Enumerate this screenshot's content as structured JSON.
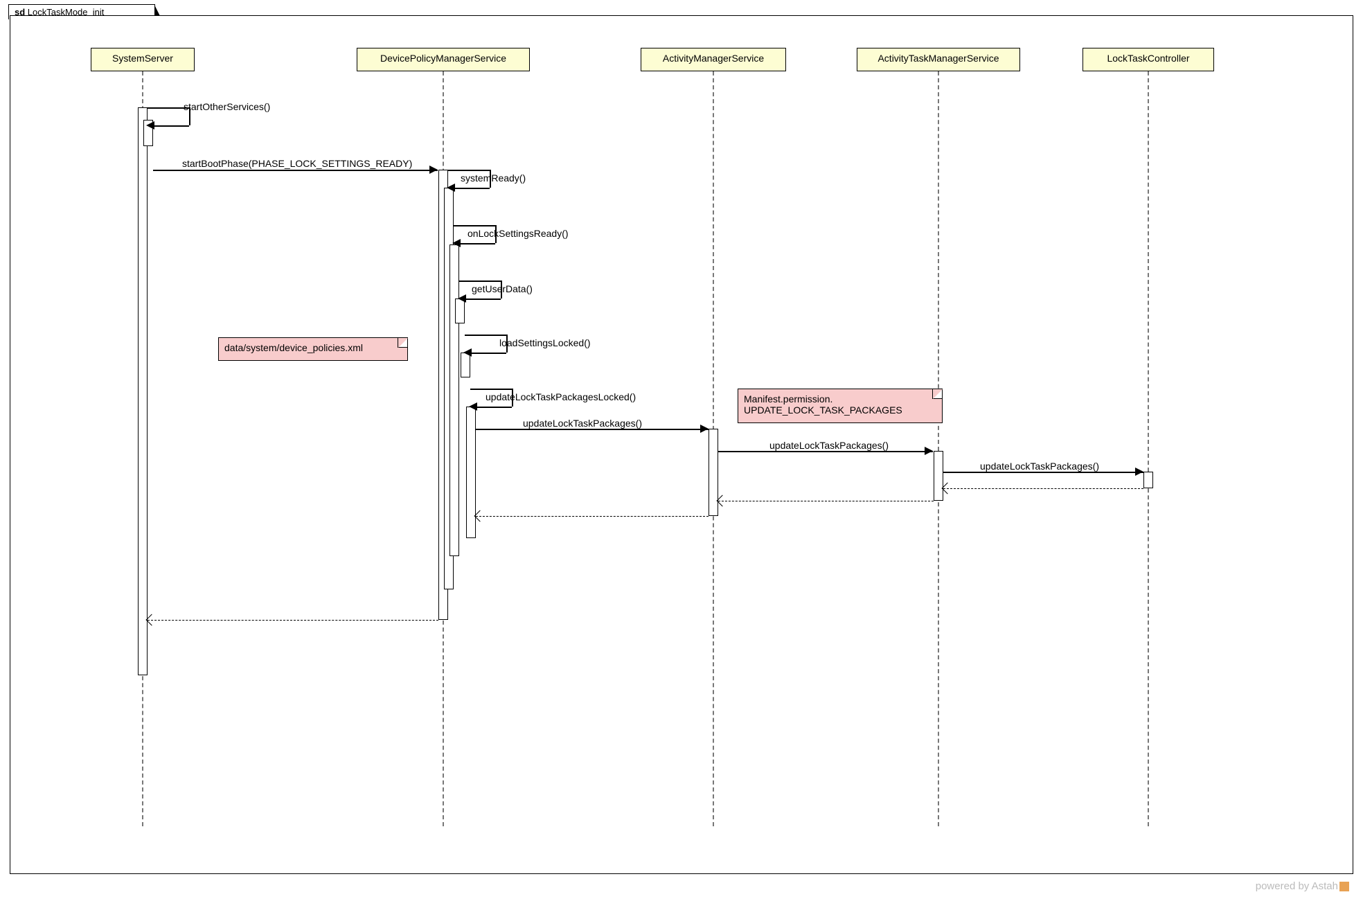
{
  "diagram": {
    "title_prefix": "sd",
    "title": "LockTaskMode_init"
  },
  "lifelines": {
    "l1": "SystemServer",
    "l2": "DevicePolicyManagerService",
    "l3": "ActivityManagerService",
    "l4": "ActivityTaskManagerService",
    "l5": "LockTaskController"
  },
  "messages": {
    "m1": "startOtherServices()",
    "m2": "startBootPhase(PHASE_LOCK_SETTINGS_READY)",
    "m3": "systemReady()",
    "m4": "onLockSettingsReady()",
    "m5": "getUserData()",
    "m6": "loadSettingsLocked()",
    "m7": "updateLockTaskPackagesLocked()",
    "m8": "updateLockTaskPackages()",
    "m9": "updateLockTaskPackages()",
    "m10": "updateLockTaskPackages()"
  },
  "notes": {
    "n1": "data/system/device_policies.xml",
    "n2_l1": "Manifest.permission.",
    "n2_l2": "UPDATE_LOCK_TASK_PACKAGES"
  },
  "footer": "powered by Astah"
}
